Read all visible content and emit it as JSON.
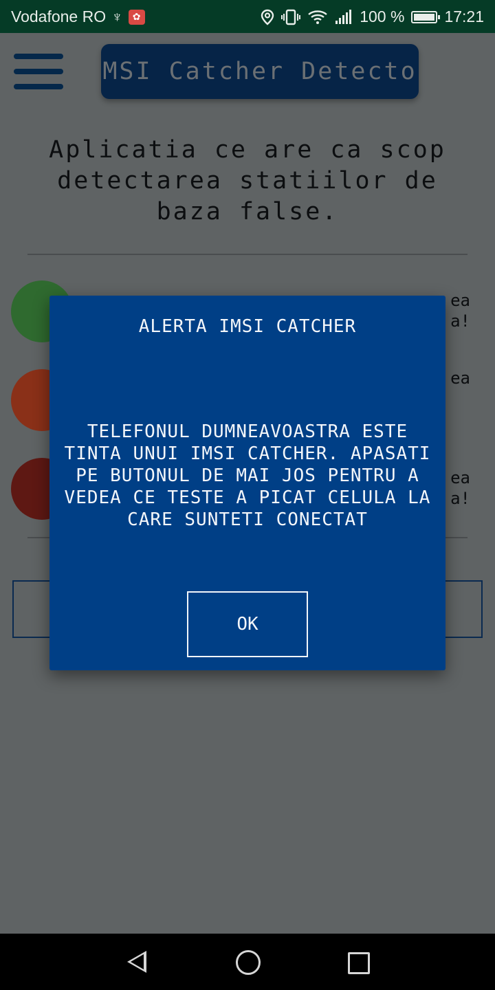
{
  "status_bar": {
    "carrier": "Vodafone RO",
    "battery_percent": "100 %",
    "battery_level": 1.0,
    "time": "17:21",
    "icons": [
      "usb-icon",
      "huawei-app-icon",
      "location-icon",
      "vibrate-icon",
      "wifi-icon",
      "signal-icon",
      "battery-icon"
    ]
  },
  "app": {
    "title": "IMSI Catcher Detector",
    "intro_text": "Aplicatia ce are ca scop detectarea statiilor de baza false.",
    "rows": [
      {
        "color": "#2f6a2f",
        "text_fragments": [
          "ea",
          "a!"
        ]
      },
      {
        "color": "#8a3018",
        "text_fragments": [
          "ea"
        ]
      },
      {
        "color": "#5e1813",
        "text_fragments": [
          "ea",
          "a!"
        ]
      }
    ]
  },
  "dialog": {
    "title": "ALERTA IMSI CATCHER",
    "message": "TELEFONUL DUMNEAVOASTRA ESTE TINTA UNUI IMSI CATCHER. APASATI PE BUTONUL DE MAI JOS PENTRU A VEDEA CE TESTE A PICAT CELULA LA CARE SUNTETI CONECTAT",
    "ok_label": "OK",
    "background": "#003f86"
  },
  "navbar": {
    "icons": [
      "back-icon",
      "home-icon",
      "recents-icon"
    ]
  }
}
